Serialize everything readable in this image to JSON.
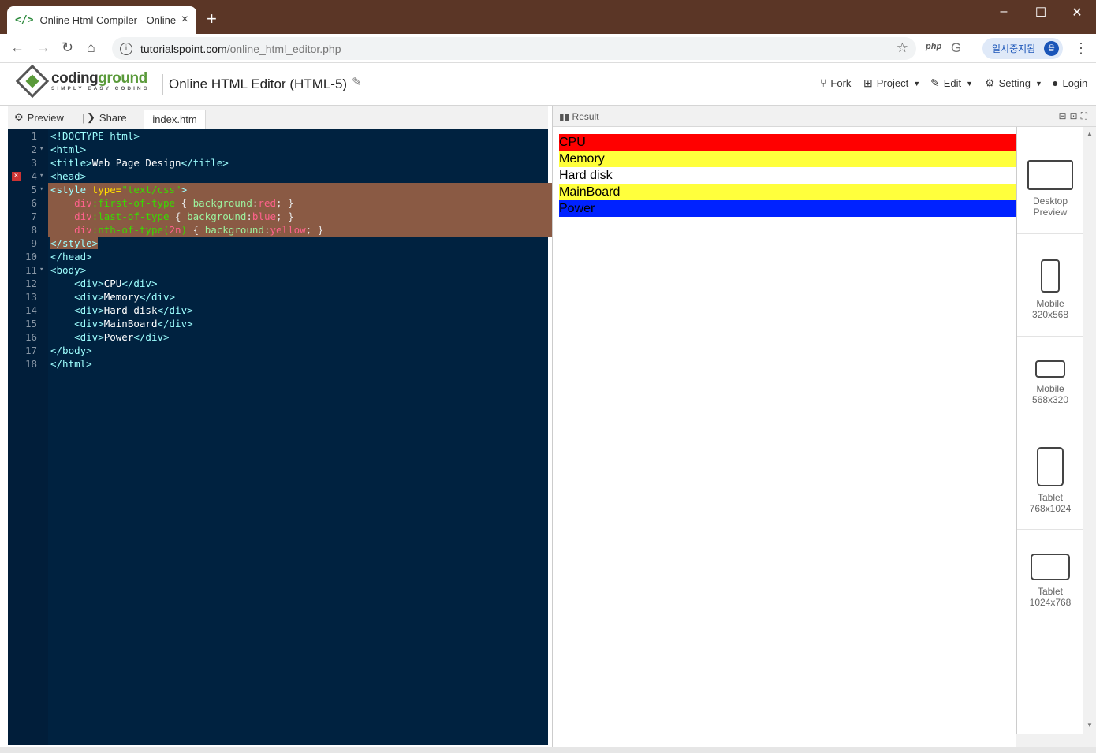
{
  "browser": {
    "tab_title": "Online Html Compiler - Online H",
    "tab_favicon": "</>",
    "url_host": "tutorialspoint.com",
    "url_path": "/online_html_editor.php",
    "ext_label": "php",
    "profile_label": "일시중지됨",
    "profile_avatar": "읍"
  },
  "header": {
    "logo_name_1": "coding",
    "logo_name_2": "ground",
    "logo_tagline": "SIMPLY EASY CODING",
    "page_title": "Online HTML Editor (HTML-5)",
    "menu": [
      {
        "label": "Fork"
      },
      {
        "label": "Project"
      },
      {
        "label": "Edit"
      },
      {
        "label": "Setting"
      },
      {
        "label": "Login"
      }
    ]
  },
  "left_toolbar": {
    "preview_label": "Preview",
    "share_label": "Share",
    "file_tab": "index.htm"
  },
  "editor": {
    "line_numbers": [
      "1",
      "2",
      "3",
      "4",
      "5",
      "6",
      "7",
      "8",
      "9",
      "10",
      "11",
      "12",
      "13",
      "14",
      "15",
      "16",
      "17",
      "18"
    ],
    "lines": [
      [
        "<!DOCTYPE html>"
      ],
      [
        "<html>"
      ],
      [
        "<title>",
        "Web Page Design",
        "</title>"
      ],
      [
        "<head>"
      ],
      [
        "<style",
        " type=",
        "\"text/css\"",
        ">"
      ],
      [
        "    div",
        ":first-of-type",
        " { ",
        "background",
        ":",
        "red",
        "; }"
      ],
      [
        "    div",
        ":last-of-type",
        " { ",
        "background",
        ":",
        "blue",
        "; }"
      ],
      [
        "    div",
        ":nth-of-type(",
        "2n",
        ")",
        " { ",
        "background",
        ":",
        "yellow",
        "; }"
      ],
      [
        "</style>"
      ],
      [
        "</head>"
      ],
      [
        "<body>"
      ],
      [
        "    <div>",
        "CPU",
        "</div>"
      ],
      [
        "    <div>",
        "Memory",
        "</div>"
      ],
      [
        "    <div>",
        "Hard disk",
        "</div>"
      ],
      [
        "    <div>",
        "MainBoard",
        "</div>"
      ],
      [
        "    <div>",
        "Power",
        "</div>"
      ],
      [
        "</body>"
      ],
      [
        "</html>"
      ]
    ]
  },
  "result": {
    "label": "Result",
    "rows": [
      {
        "text": "CPU",
        "bg": "#ff0000"
      },
      {
        "text": "Memory",
        "bg": "#ffff3c"
      },
      {
        "text": "Hard disk",
        "bg": "#ffffff"
      },
      {
        "text": "MainBoard",
        "bg": "#ffff3c"
      },
      {
        "text": "Power",
        "bg": "#0022ff"
      }
    ]
  },
  "devices": [
    {
      "line1": "Desktop",
      "line2": "Preview"
    },
    {
      "line1": "Mobile",
      "line2": "320x568"
    },
    {
      "line1": "Mobile",
      "line2": "568x320"
    },
    {
      "line1": "Tablet",
      "line2": "768x1024"
    },
    {
      "line1": "Tablet",
      "line2": "1024x768"
    }
  ],
  "colors": {
    "titlebar": "#5b3626",
    "editor_bg": "#002240",
    "highlight": "#8a5a44",
    "brand_green": "#5a9a3a"
  }
}
